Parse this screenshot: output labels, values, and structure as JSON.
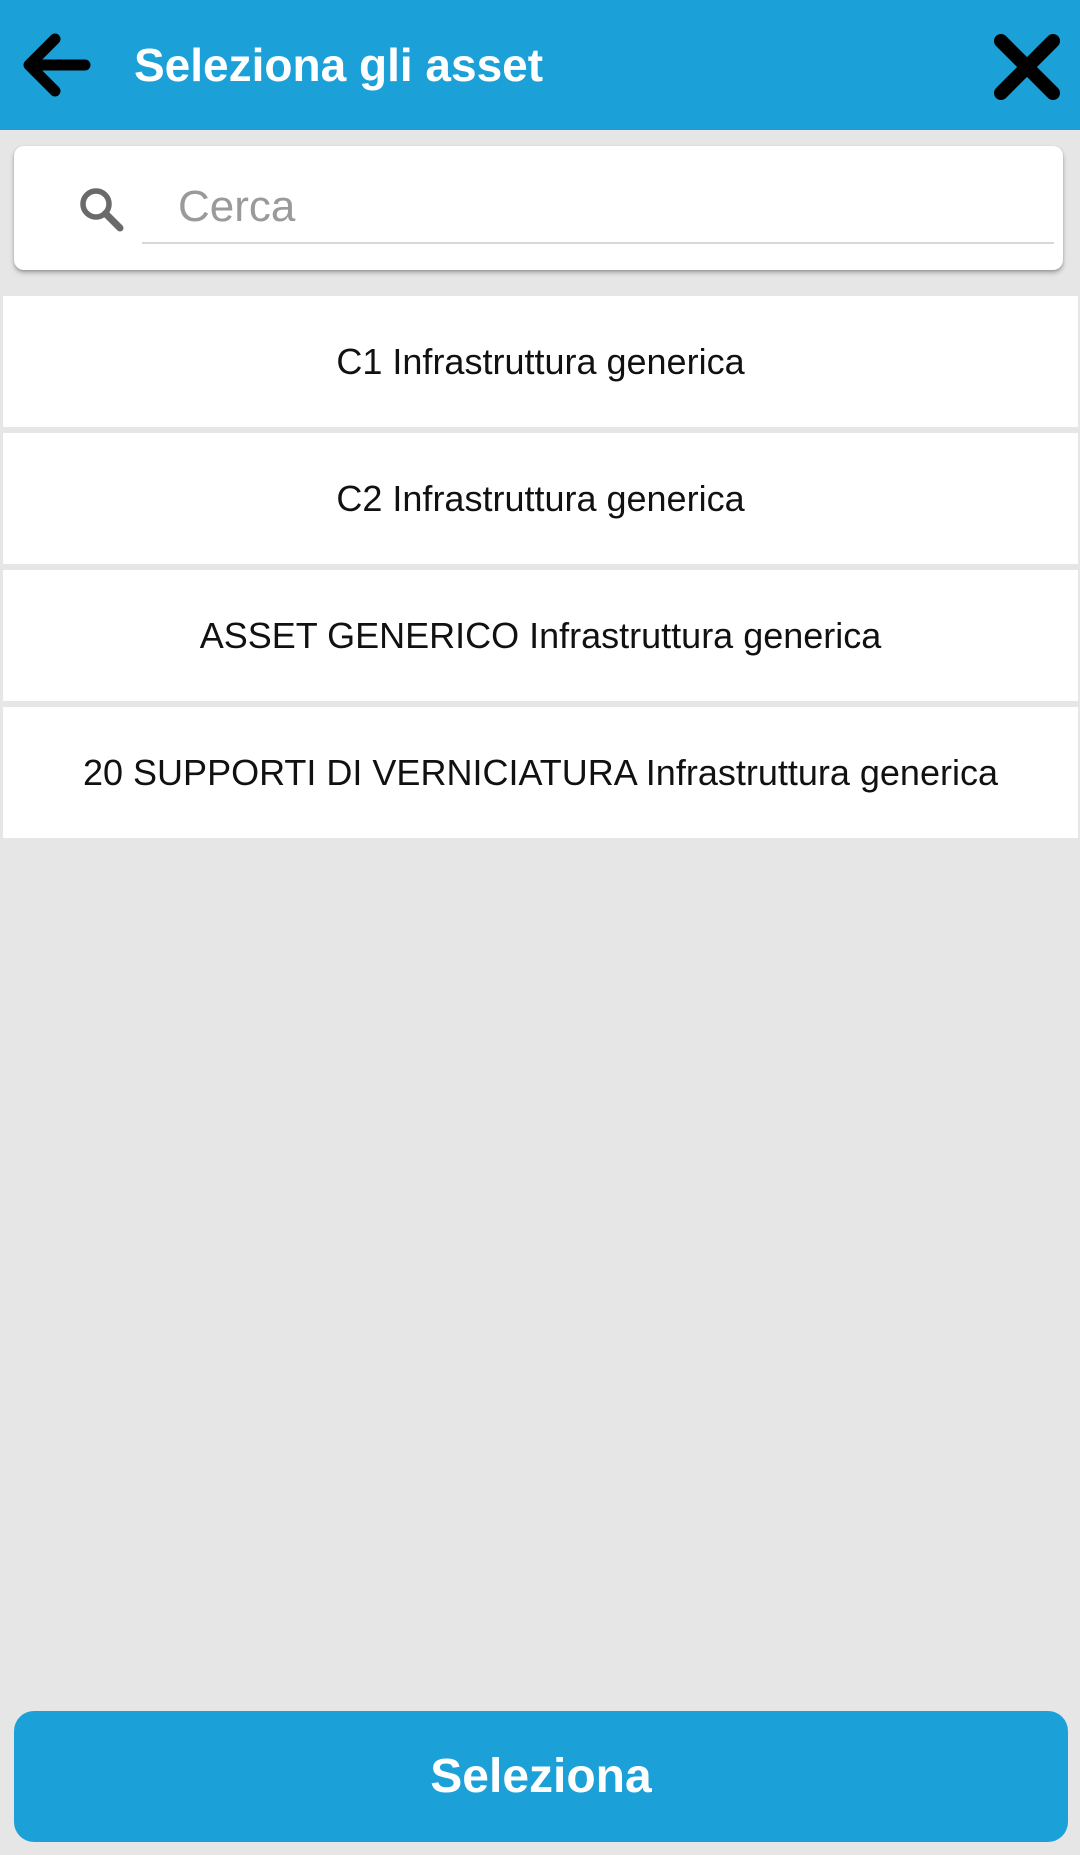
{
  "header": {
    "title": "Seleziona gli asset",
    "back_icon": "arrow-back-icon",
    "close_icon": "close-icon",
    "background_color": "#1ba1d8"
  },
  "search": {
    "placeholder": "Cerca",
    "value": "",
    "icon": "search-icon"
  },
  "assets": [
    {
      "label": "C1 Infrastruttura generica"
    },
    {
      "label": "C2 Infrastruttura generica"
    },
    {
      "label": "ASSET GENERICO Infrastruttura generica"
    },
    {
      "label": "20 SUPPORTI DI VERNICIATURA Infrastruttura generica"
    }
  ],
  "footer": {
    "select_label": "Seleziona",
    "button_color": "#1ba1d8"
  }
}
